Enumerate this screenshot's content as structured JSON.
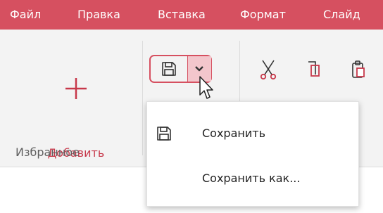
{
  "menubar": {
    "items": [
      "Файл",
      "Правка",
      "Вставка",
      "Формат",
      "Слайд"
    ]
  },
  "ribbon": {
    "add_label": "Добавить",
    "favorites_group_label": "Избранное"
  },
  "dropdown": {
    "items": [
      {
        "label": "Сохранить",
        "icon": "save-icon"
      },
      {
        "label": "Сохранить как...",
        "icon": ""
      }
    ]
  },
  "colors": {
    "accent": "#d65060",
    "accent_text": "#c7384a",
    "ribbon_bg": "#f3f3f3"
  },
  "icons": [
    "plus-icon",
    "save-icon",
    "chevron-down-icon",
    "scissors-icon",
    "copy-icon",
    "paste-icon",
    "mouse-cursor-icon"
  ]
}
